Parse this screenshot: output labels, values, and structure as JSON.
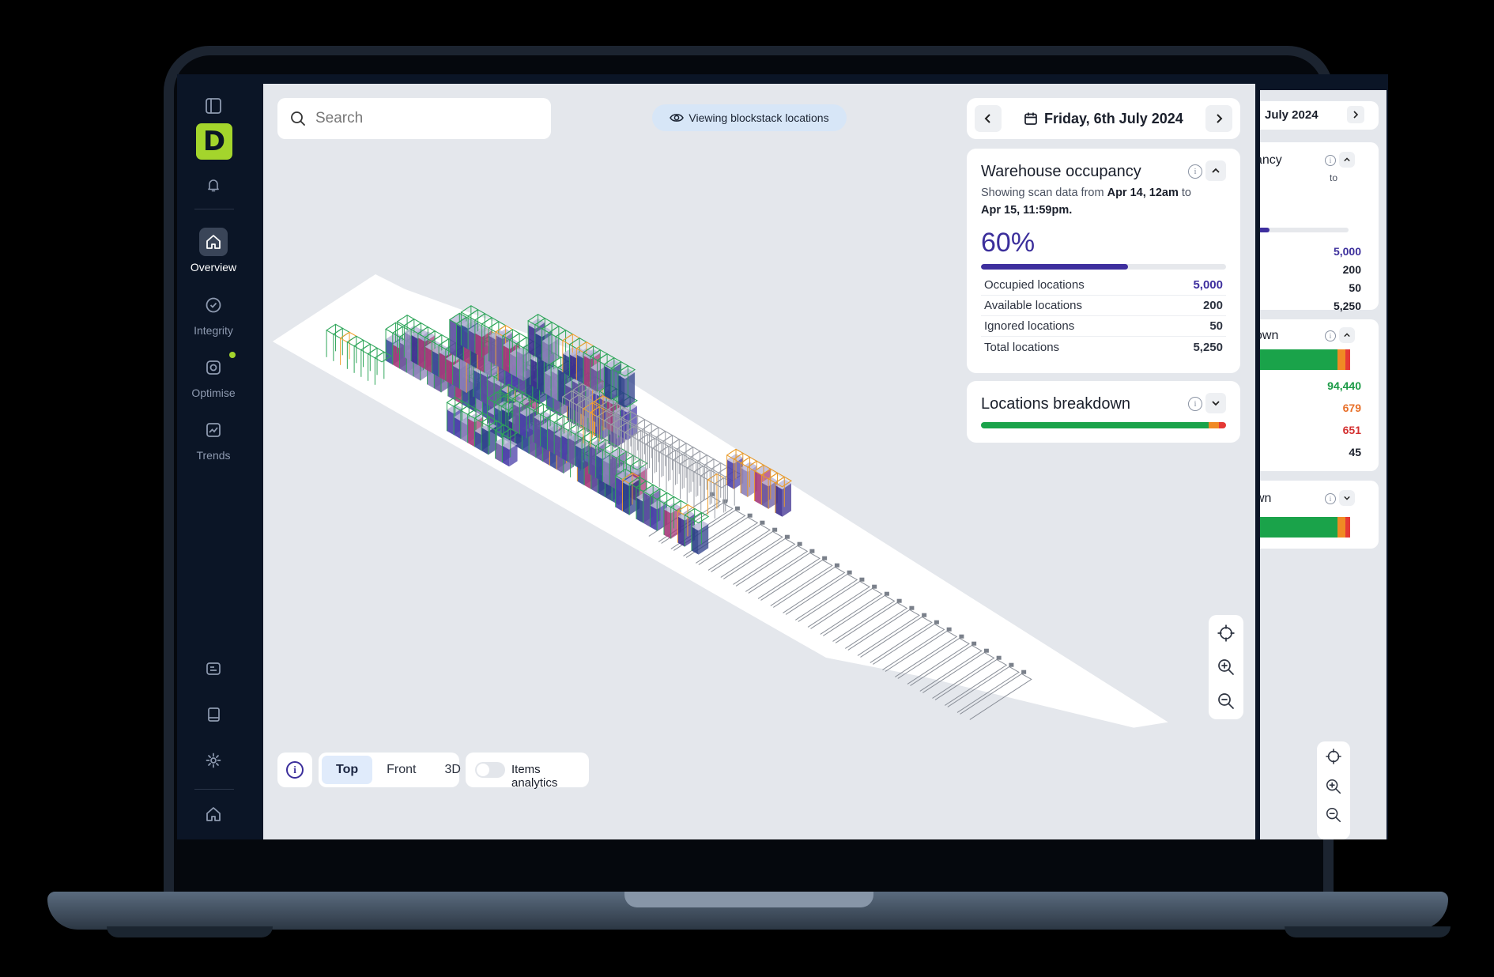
{
  "sidebar": {
    "logo_letter": "D",
    "nav": [
      {
        "label": "Overview",
        "icon": "home-icon",
        "active": true
      },
      {
        "label": "Integrity",
        "icon": "check-circle-icon",
        "active": false
      },
      {
        "label": "Optimise",
        "icon": "optimise-icon",
        "active": false,
        "badge": true
      },
      {
        "label": "Trends",
        "icon": "trends-icon",
        "active": false
      }
    ],
    "badge_color": "#a4d52c"
  },
  "search": {
    "placeholder": "Search"
  },
  "view_pill": {
    "label": "Viewing blockstack locations"
  },
  "date_nav": {
    "date": "Friday, 6th July 2024"
  },
  "occupancy": {
    "title": "Warehouse occupancy",
    "subtitle_prefix": "Showing scan data from",
    "from": "Apr 14, 12am",
    "to_word": "to",
    "to": "Apr 15, 11:59pm.",
    "percent_label": "60%",
    "percent_value": 0.6,
    "stats": [
      {
        "label": "Occupied locations",
        "value": "5,000"
      },
      {
        "label": "Available locations",
        "value": "200"
      },
      {
        "label": "Ignored locations",
        "value": "50"
      },
      {
        "label": "Total locations",
        "value": "5,250"
      }
    ],
    "accent_color": "#3e2f9e"
  },
  "breakdown": {
    "title": "Locations breakdown",
    "segments": [
      {
        "fraction": 0.93,
        "color": "#1aa34a"
      },
      {
        "fraction": 0.04,
        "color": "#f08a24"
      },
      {
        "fraction": 0.03,
        "color": "#e53935"
      }
    ]
  },
  "view_modes": {
    "options": [
      "Top",
      "Front",
      "3D"
    ],
    "selected": "Top"
  },
  "items_analytics": {
    "label": "Items analytics",
    "enabled": false
  },
  "second_window": {
    "date_fragment": "July 2024",
    "occupancy_title_fragment": "ancy",
    "subtitle_fragment_1": "n",
    "subtitle_fragment_2": "to",
    "stats": [
      "5,000",
      "200",
      "50",
      "5,250"
    ],
    "breakdown_title_fragment": "own",
    "breakdown_values": [
      {
        "value": "94,440",
        "color": "#1a9a45"
      },
      {
        "value": "679",
        "color": "#e8702a"
      },
      {
        "value": "651",
        "color": "#d32f2f"
      },
      {
        "value": "45",
        "color": "#1a1f2b"
      }
    ],
    "third_title_fragment": "wn"
  }
}
